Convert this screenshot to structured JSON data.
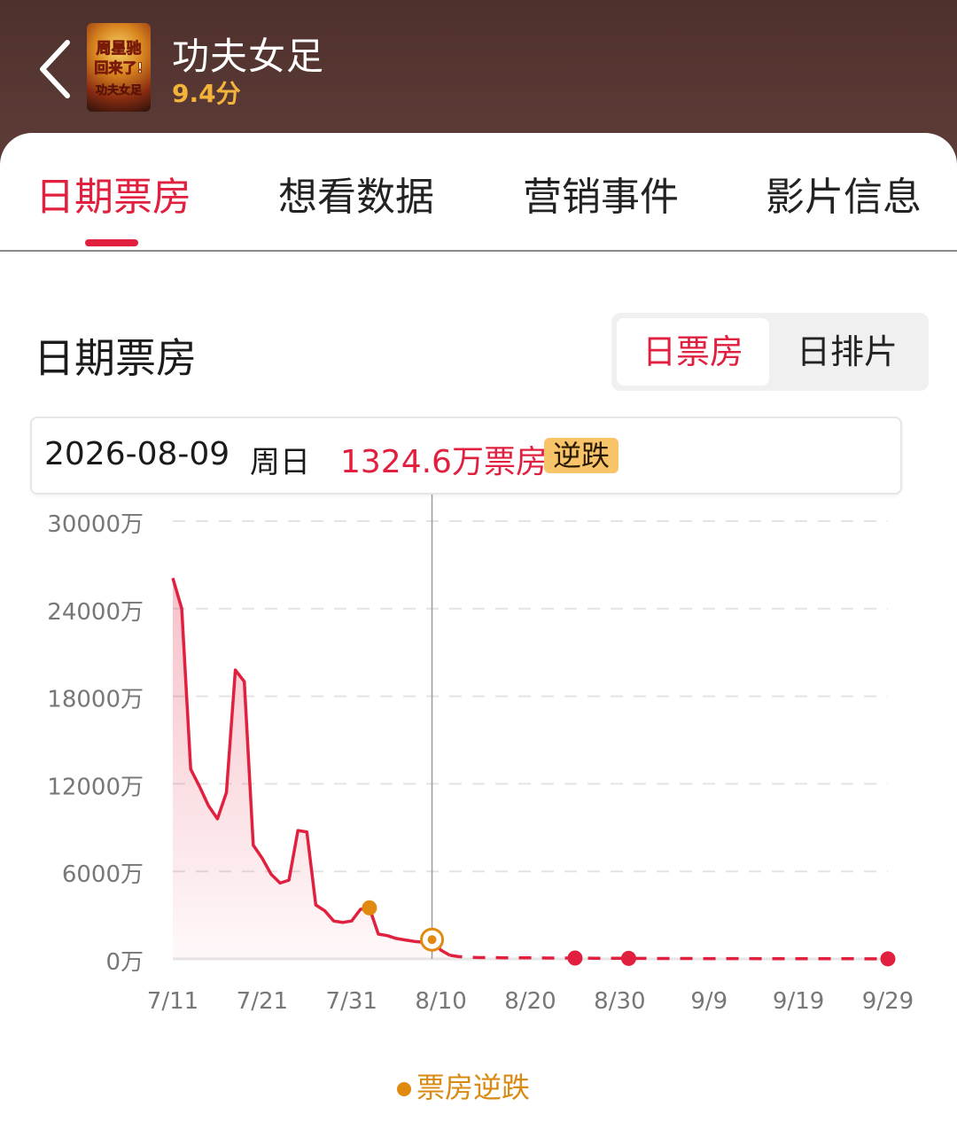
{
  "header": {
    "title": "功夫女足",
    "score": "9.4分",
    "poster_text": [
      "周星驰",
      "回来了!",
      "功夫女足"
    ]
  },
  "tabs": [
    {
      "label": "日期票房",
      "active": true
    },
    {
      "label": "想看数据",
      "active": false
    },
    {
      "label": "营销事件",
      "active": false
    },
    {
      "label": "影片信息",
      "active": false
    }
  ],
  "section": {
    "title": "日期票房",
    "toggle": {
      "selected": "日票房",
      "other": "日排片"
    }
  },
  "info": {
    "date": "2026-08-09",
    "weekday": "周日",
    "value": "1324.6万票房",
    "badge": "逆跌"
  },
  "legend": {
    "label": "票房逆跌"
  },
  "colors": {
    "accent": "#e0203e",
    "highlight": "#e08a12",
    "header_bg": "#5b3a35"
  },
  "chart_data": {
    "type": "area",
    "xlabel": "",
    "ylabel": "",
    "ylim": [
      0,
      30000
    ],
    "y_ticks": [
      "0万",
      "6000万",
      "12000万",
      "18000万",
      "24000万",
      "30000万"
    ],
    "y_tick_values": [
      0,
      6000,
      12000,
      18000,
      24000,
      30000
    ],
    "x_ticks": [
      "7/11",
      "7/21",
      "7/31",
      "8/10",
      "8/20",
      "8/30",
      "9/9",
      "9/19",
      "9/29"
    ],
    "x_start": "7/11",
    "x_end": "9/29",
    "series": [
      {
        "points": [
          [
            "7/11",
            26100
          ],
          [
            "7/12",
            24000
          ],
          [
            "7/13",
            13000
          ],
          [
            "7/14",
            11800
          ],
          [
            "7/15",
            10500
          ],
          [
            "7/16",
            9600
          ],
          [
            "7/17",
            11400
          ],
          [
            "7/18",
            19800
          ],
          [
            "7/19",
            19000
          ],
          [
            "7/20",
            7800
          ],
          [
            "7/21",
            6900
          ],
          [
            "7/22",
            5800
          ],
          [
            "7/23",
            5200
          ],
          [
            "7/24",
            5400
          ],
          [
            "7/25",
            8800
          ],
          [
            "7/26",
            8700
          ],
          [
            "7/27",
            3700
          ],
          [
            "7/28",
            3300
          ],
          [
            "7/29",
            2600
          ],
          [
            "7/30",
            2500
          ],
          [
            "7/31",
            2600
          ],
          [
            "8/1",
            3400
          ],
          [
            "8/2",
            3500
          ],
          [
            "8/3",
            1700
          ],
          [
            "8/4",
            1600
          ],
          [
            "8/5",
            1400
          ],
          [
            "8/6",
            1300
          ],
          [
            "8/7",
            1200
          ],
          [
            "8/8",
            1150
          ],
          [
            "8/9",
            1324.6
          ],
          [
            "8/10",
            600
          ],
          [
            "8/11",
            250
          ]
        ]
      },
      {
        "style": "dashed",
        "points": [
          [
            "8/11",
            250
          ],
          [
            "8/12",
            160
          ],
          [
            "8/13",
            120
          ],
          [
            "8/14",
            100
          ],
          [
            "8/15",
            90
          ],
          [
            "8/16",
            90
          ],
          [
            "8/17",
            80
          ],
          [
            "8/18",
            80
          ],
          [
            "8/19",
            75
          ],
          [
            "8/20",
            70
          ],
          [
            "8/21",
            70
          ],
          [
            "8/22",
            60
          ],
          [
            "8/23",
            60
          ],
          [
            "8/24",
            60
          ],
          [
            "8/25",
            60
          ],
          [
            "8/26",
            55
          ],
          [
            "8/27",
            50
          ],
          [
            "8/28",
            45
          ],
          [
            "8/29",
            45
          ],
          [
            "8/30",
            40
          ],
          [
            "9/1",
            35
          ],
          [
            "9/5",
            30
          ],
          [
            "9/10",
            25
          ],
          [
            "9/15",
            20
          ],
          [
            "9/20",
            15
          ],
          [
            "9/25",
            10
          ],
          [
            "9/29",
            5
          ]
        ]
      }
    ],
    "highlight_points": [
      {
        "x": "8/2",
        "value": 3500,
        "label": "票房逆跌"
      }
    ],
    "selected_point": {
      "x": "8/9",
      "value": 1324.6
    },
    "event_markers": [
      {
        "x": "8/25",
        "value": 60
      },
      {
        "x": "8/31",
        "value": 40
      },
      {
        "x": "9/29",
        "value": 5
      }
    ],
    "legend": [
      "票房逆跌"
    ],
    "grid": true
  }
}
